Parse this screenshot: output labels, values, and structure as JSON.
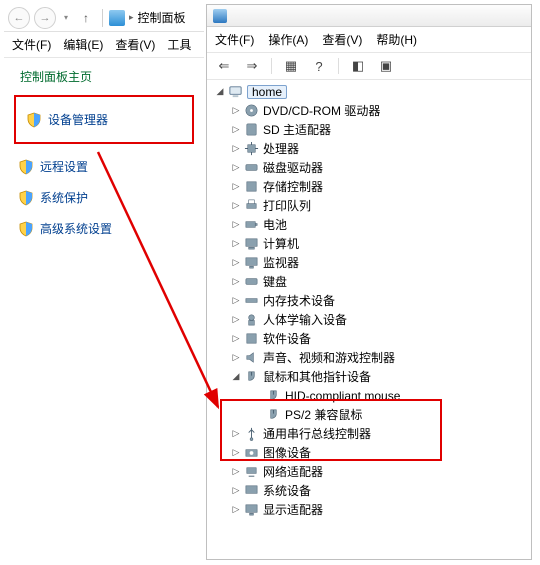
{
  "cp": {
    "address": "控制面板",
    "menu": {
      "file": "文件(F)",
      "edit": "编辑(E)",
      "view": "查看(V)",
      "tools": "工具"
    },
    "section_title": "控制面板主页",
    "items": {
      "device_manager": "设备管理器",
      "remote_settings": "远程设置",
      "system_protect": "系统保护",
      "advanced_system": "高级系统设置"
    }
  },
  "dm": {
    "menu": {
      "file": "文件(F)",
      "action": "操作(A)",
      "view": "查看(V)",
      "help": "帮助(H)"
    },
    "root": "home",
    "categories": {
      "dvd": "DVD/CD-ROM 驱动器",
      "sd": "SD 主适配器",
      "cpu": "处理器",
      "disk": "磁盘驱动器",
      "storage": "存储控制器",
      "print": "打印队列",
      "battery": "电池",
      "computer": "计算机",
      "monitor": "监视器",
      "keyboard": "键盘",
      "memtech": "内存技术设备",
      "hid": "人体学输入设备",
      "software": "软件设备",
      "sound": "声音、视频和游戏控制器",
      "mouse": "鼠标和其他指针设备",
      "usb": "通用串行总线控制器",
      "image": "图像设备",
      "network": "网络适配器",
      "system": "系统设备",
      "display": "显示适配器"
    },
    "mouse_children": {
      "hid_mouse": "HID-compliant mouse",
      "ps2_mouse": "PS/2 兼容鼠标"
    }
  }
}
